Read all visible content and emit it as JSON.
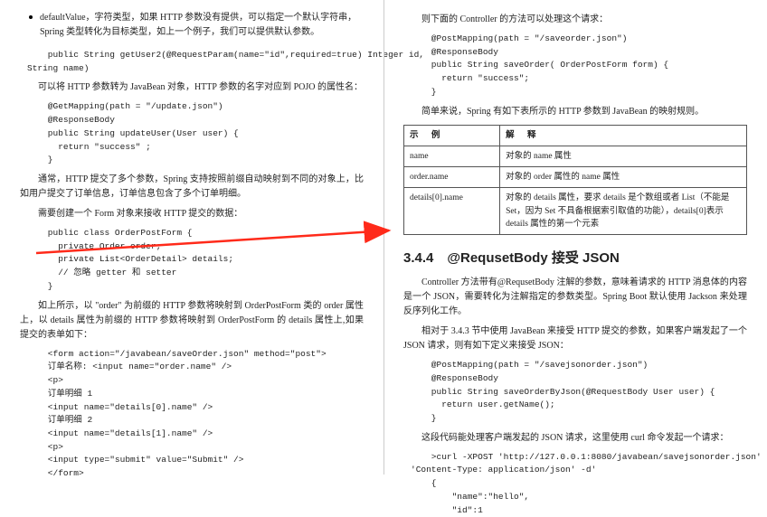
{
  "left": {
    "bullet1": "defaultValue，字符类型，如果 HTTP 参数没有提供，可以指定一个默认字符串，Spring 类型转化为目标类型，如上一个例子，我们可以提供默认参数。",
    "code1": "    public String getUser2(@RequestParam(name=\"id\",required=true) Integer id,\nString name)",
    "p1": "可以将 HTTP 参数转为 JavaBean 对象，HTTP 参数的名字对应到 POJO 的属性名：",
    "code2": "    @GetMapping(path = \"/update.json\")\n    @ResponseBody\n    public String updateUser(User user) {\n      return \"success\" ;\n    }",
    "p2": "通常，HTTP 提交了多个参数，Spring 支持按照前缀自动映射到不同的对象上，比如用户提交了订单信息，订单信息包含了多个订单明细。",
    "p3": "需要创建一个 Form 对象来接收 HTTP 提交的数据：",
    "code3": "    public class OrderPostForm {\n      private Order order;\n      private List<OrderDetail> details;\n      // 忽略 getter 和 setter\n    }",
    "p4": "如上所示，以 \"order\" 为前缀的 HTTP 参数将映射到 OrderPostForm 类的 order 属性上，以 details 属性为前缀的 HTTP 参数将映射到 OrderPostForm 的 details 属性上,如果提交的表单如下：",
    "code4": "    <form action=\"/javabean/saveOrder.json\" method=\"post\">\n    订单名称: <input name=\"order.name\" />\n    <p>\n    订单明细 1\n    <input name=\"details[0].name\" />\n    订单明细 2\n    <input name=\"details[1].name\" />\n    <p>\n    <input type=\"submit\" value=\"Submit\" />\n    </form>"
  },
  "right": {
    "p1": "则下面的 Controller 的方法可以处理这个请求：",
    "code1": "    @PostMapping(path = \"/saveorder.json\")\n    @ResponseBody\n    public String saveOrder( OrderPostForm form) {\n      return \"success\";\n    }",
    "p2": "简单来说，Spring 有如下表所示的 HTTP 参数到 JavaBean 的映射规则。",
    "table": {
      "h1": "示   例",
      "h2": "解   释",
      "r1c1": "name",
      "r1c2": "对象的 name 属性",
      "r2c1": "order.name",
      "r2c2": "对象的 order 属性的 name 属性",
      "r3c1": "details[0].name",
      "r3c2": "对象的 details 属性，要求 details 是个数组或者 List（不能是 Set，因为 Set 不具备根据索引取值的功能），details[0]表示 details 属性的第一个元素"
    },
    "h2": "3.4.4　@RequsetBody 接受 JSON",
    "p3": "Controller 方法带有@RequsetBody 注解的参数，意味着请求的 HTTP 消息体的内容是一个 JSON，需要转化为注解指定的参数类型。Spring Boot 默认使用 Jackson 来处理反序列化工作。",
    "p4": "相对于 3.4.3 节中使用 JavaBean 来接受 HTTP 提交的参数，如果客户端发起了一个 JSON 请求，则有如下定义来接受 JSON：",
    "code2": "    @PostMapping(path = \"/savejsonorder.json\")\n    @ResponseBody\n    public String saveOrderByJson(@RequestBody User user) {\n      return user.getName();\n    }",
    "p5": "这段代码能处理客户端发起的 JSON 请求，这里使用 curl 命令发起一个请求：",
    "code3": "    >curl -XPOST 'http://127.0.0.1:8080/javabean/savejsonorder.json' -H\n'Content-Type: application/json' -d'\n    {\n        \"name\":\"hello\",\n        \"id\":1"
  }
}
